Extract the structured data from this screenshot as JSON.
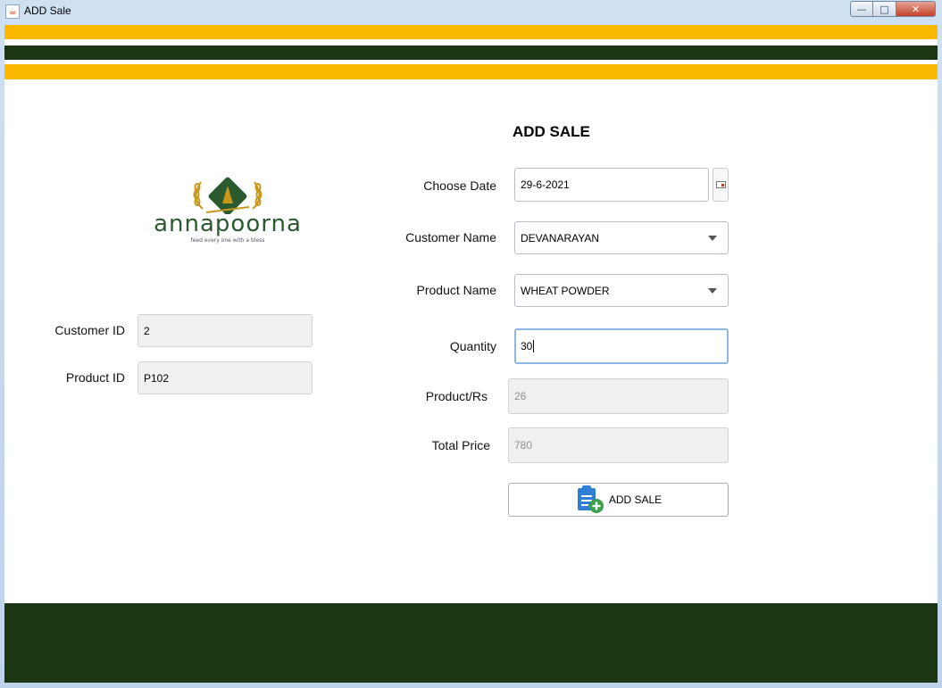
{
  "window": {
    "title": "ADD Sale",
    "controls": {
      "minimize": "—",
      "maximize": "□",
      "close": "✕"
    }
  },
  "theme": {
    "gold": "#fbb800",
    "dark_green": "#1a3612",
    "white": "#ffffff",
    "logo_green": "#2b5a2f",
    "logo_gold": "#c8961a",
    "icon_blue": "#2f7fd6",
    "icon_green": "#3aa04a"
  },
  "logo": {
    "brand": "annapoorna",
    "tagline": "feed every one with a bless"
  },
  "form": {
    "title": "ADD SALE",
    "choose_date": {
      "label": "Choose Date",
      "value": "29-6-2021"
    },
    "customer_name": {
      "label": "Customer Name",
      "value": "DEVANARAYAN"
    },
    "product_name": {
      "label": "Product Name",
      "value": "WHEAT POWDER"
    },
    "quantity": {
      "label": "Quantity",
      "value": "30"
    },
    "product_price": {
      "label": "Product/Rs",
      "value": "26"
    },
    "total_price": {
      "label": "Total Price",
      "value": "780"
    },
    "submit_label": "ADD SALE"
  },
  "ids": {
    "customer_id": {
      "label": "Customer ID",
      "value": "2"
    },
    "product_id": {
      "label": "Product ID",
      "value": "P102"
    }
  },
  "icons": {
    "app": "java-cup-icon",
    "calendar": "calendar-icon",
    "dropdown": "chevron-down-icon",
    "add_sale": "clipboard-add-icon"
  }
}
